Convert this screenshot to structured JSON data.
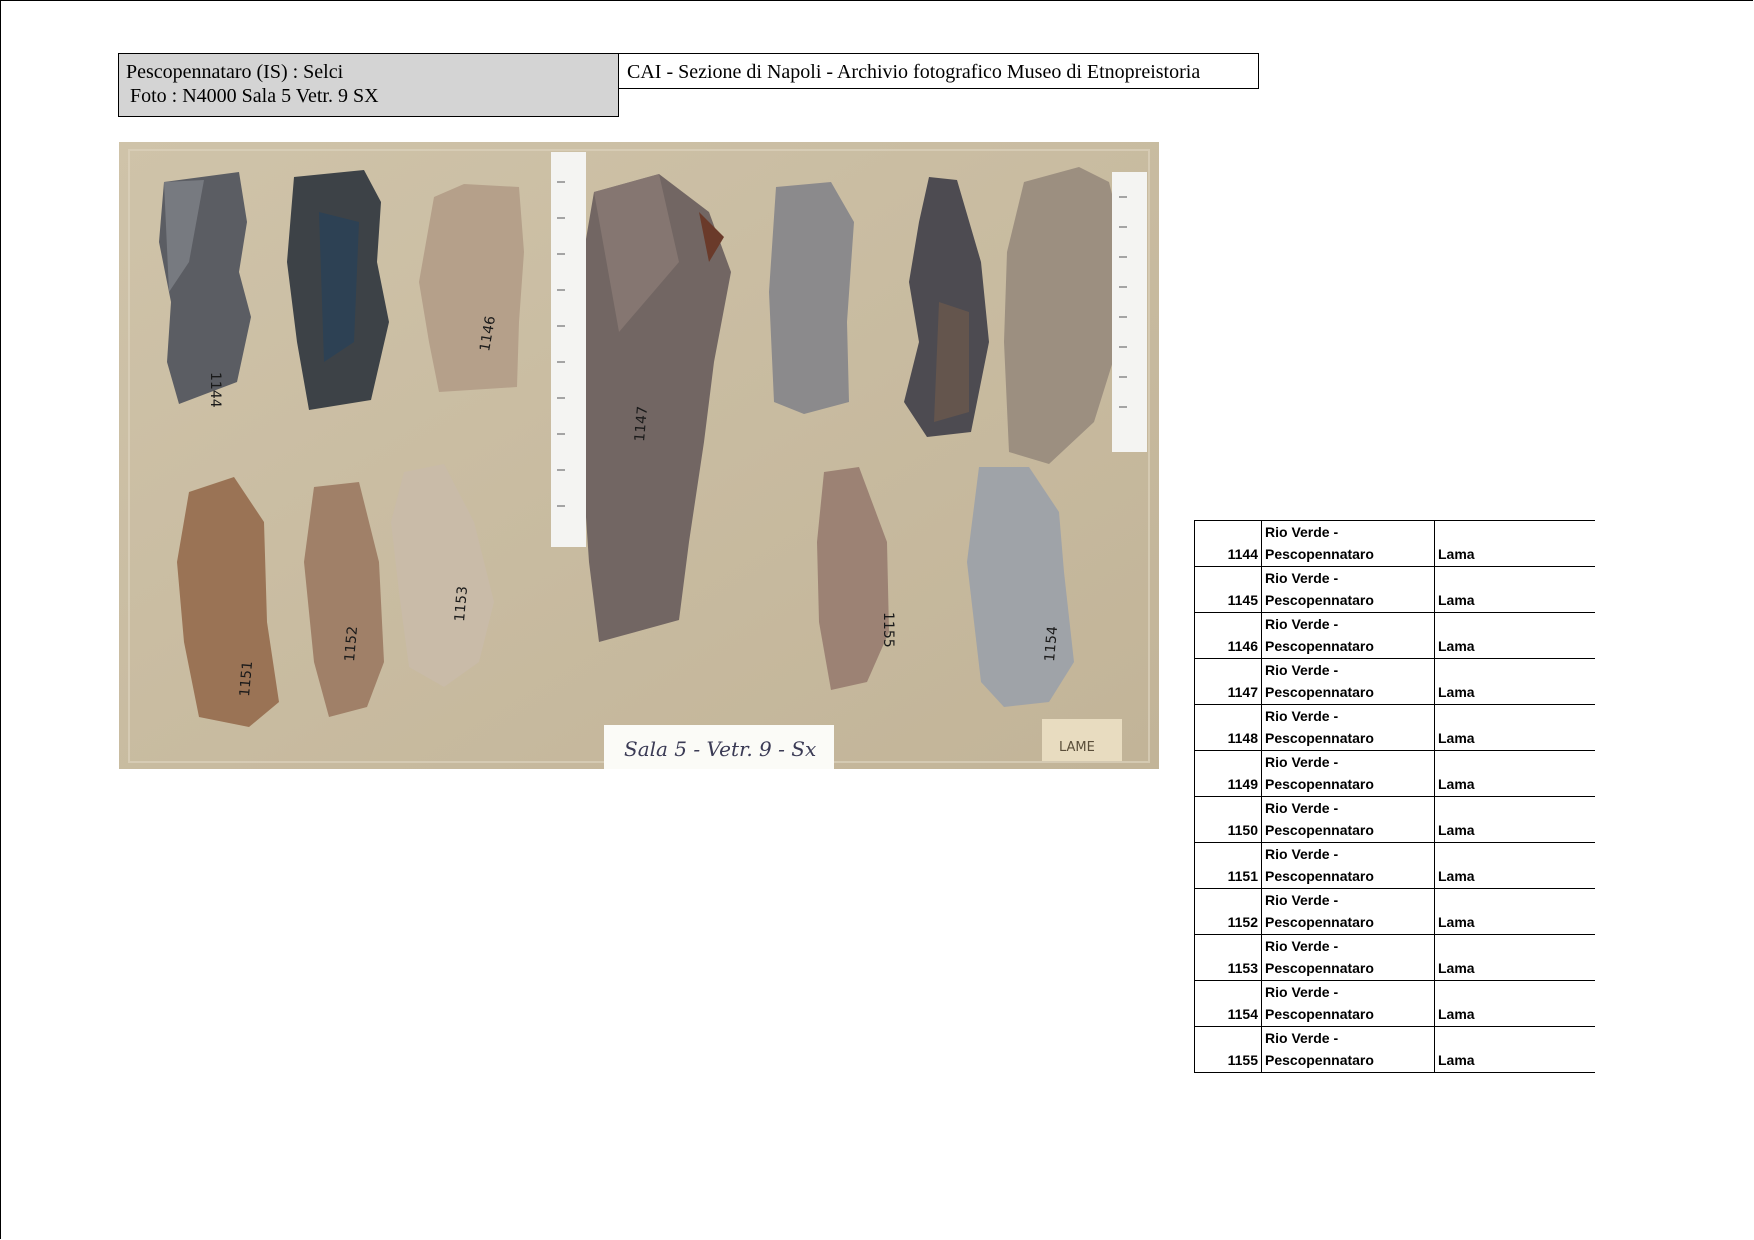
{
  "header": {
    "site_line": "Pescopennataro  (IS)   :  Selci",
    "photo_line": "Foto : N4000  Sala 5 Vetr. 9 SX",
    "archive_line": "CAI - Sezione di Napoli  - Archivio fotografico Museo di Etnopreistoria"
  },
  "photo": {
    "label_card": "Sala 5 - Vetr. 9 - Sx",
    "corner_tag": "LAME",
    "artifact_numbers": [
      "1144",
      "1146",
      "1147",
      "1151",
      "1152",
      "1153",
      "1154",
      "1155"
    ]
  },
  "inventory": {
    "rows": [
      {
        "num": "1144",
        "loc1": "Rio Verde -",
        "loc2": "Pescopennataro",
        "type": "Lama"
      },
      {
        "num": "1145",
        "loc1": "Rio Verde -",
        "loc2": "Pescopennataro",
        "type": "Lama"
      },
      {
        "num": "1146",
        "loc1": "Rio Verde -",
        "loc2": "Pescopennataro",
        "type": "Lama"
      },
      {
        "num": "1147",
        "loc1": "Rio Verde -",
        "loc2": "Pescopennataro",
        "type": "Lama"
      },
      {
        "num": "1148",
        "loc1": "Rio Verde -",
        "loc2": "Pescopennataro",
        "type": "Lama"
      },
      {
        "num": "1149",
        "loc1": "Rio Verde -",
        "loc2": "Pescopennataro",
        "type": "Lama"
      },
      {
        "num": "1150",
        "loc1": "Rio Verde -",
        "loc2": "Pescopennataro",
        "type": "Lama"
      },
      {
        "num": "1151",
        "loc1": "Rio Verde -",
        "loc2": "Pescopennataro",
        "type": "Lama"
      },
      {
        "num": "1152",
        "loc1": "Rio Verde -",
        "loc2": "Pescopennataro",
        "type": "Lama"
      },
      {
        "num": "1153",
        "loc1": "Rio Verde -",
        "loc2": "Pescopennataro",
        "type": "Lama"
      },
      {
        "num": "1154",
        "loc1": "Rio Verde -",
        "loc2": "Pescopennataro",
        "type": "Lama"
      },
      {
        "num": "1155",
        "loc1": "Rio Verde -",
        "loc2": "Pescopennataro",
        "type": "Lama"
      }
    ]
  }
}
